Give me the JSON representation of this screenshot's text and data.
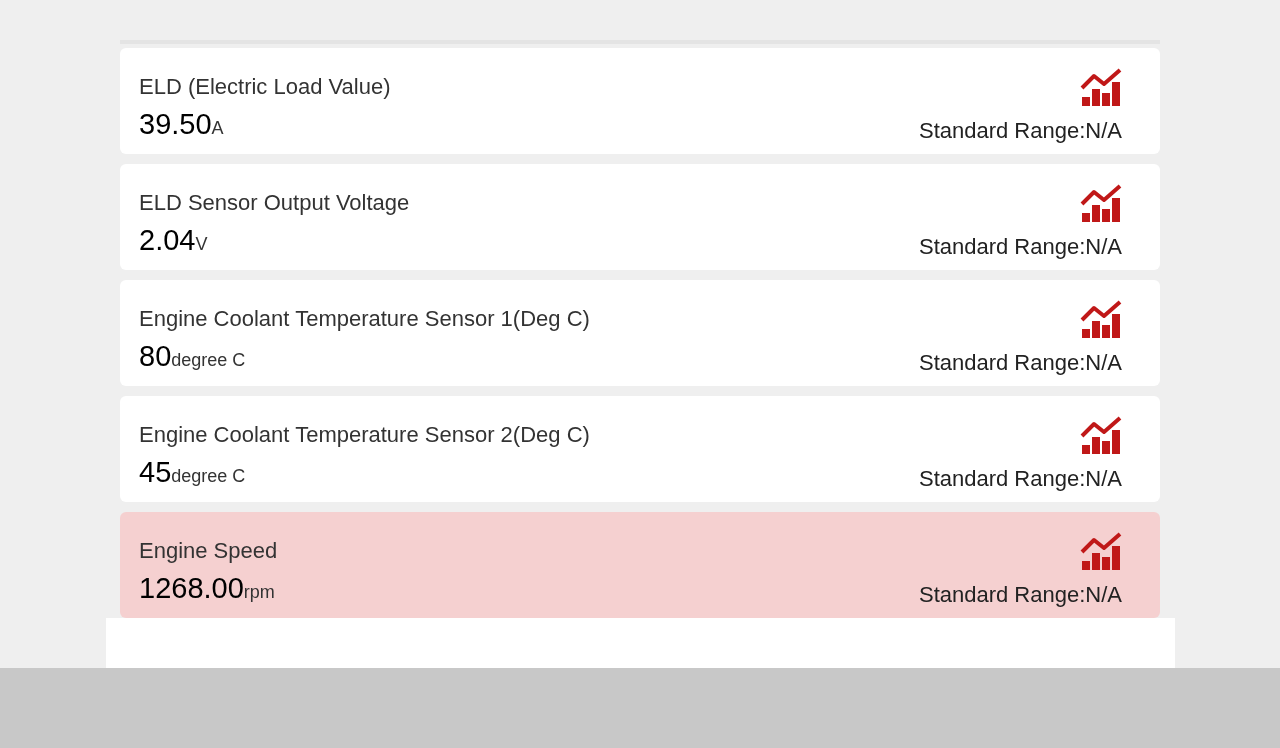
{
  "parameters": [
    {
      "name": "ELD (Electric Load Value)",
      "value": "39.50",
      "unit": "A",
      "range": "Standard Range:N/A",
      "selected": false
    },
    {
      "name": "ELD Sensor Output Voltage",
      "value": "2.04",
      "unit": "V",
      "range": "Standard Range:N/A",
      "selected": false
    },
    {
      "name": "Engine Coolant Temperature Sensor 1(Deg C)",
      "value": "80",
      "unit": "degree C",
      "range": "Standard Range:N/A",
      "selected": false
    },
    {
      "name": "Engine Coolant Temperature Sensor 2(Deg C)",
      "value": "45",
      "unit": "degree C",
      "range": "Standard Range:N/A",
      "selected": false
    },
    {
      "name": "Engine Speed",
      "value": "1268.00",
      "unit": "rpm",
      "range": "Standard Range:N/A",
      "selected": true
    }
  ]
}
